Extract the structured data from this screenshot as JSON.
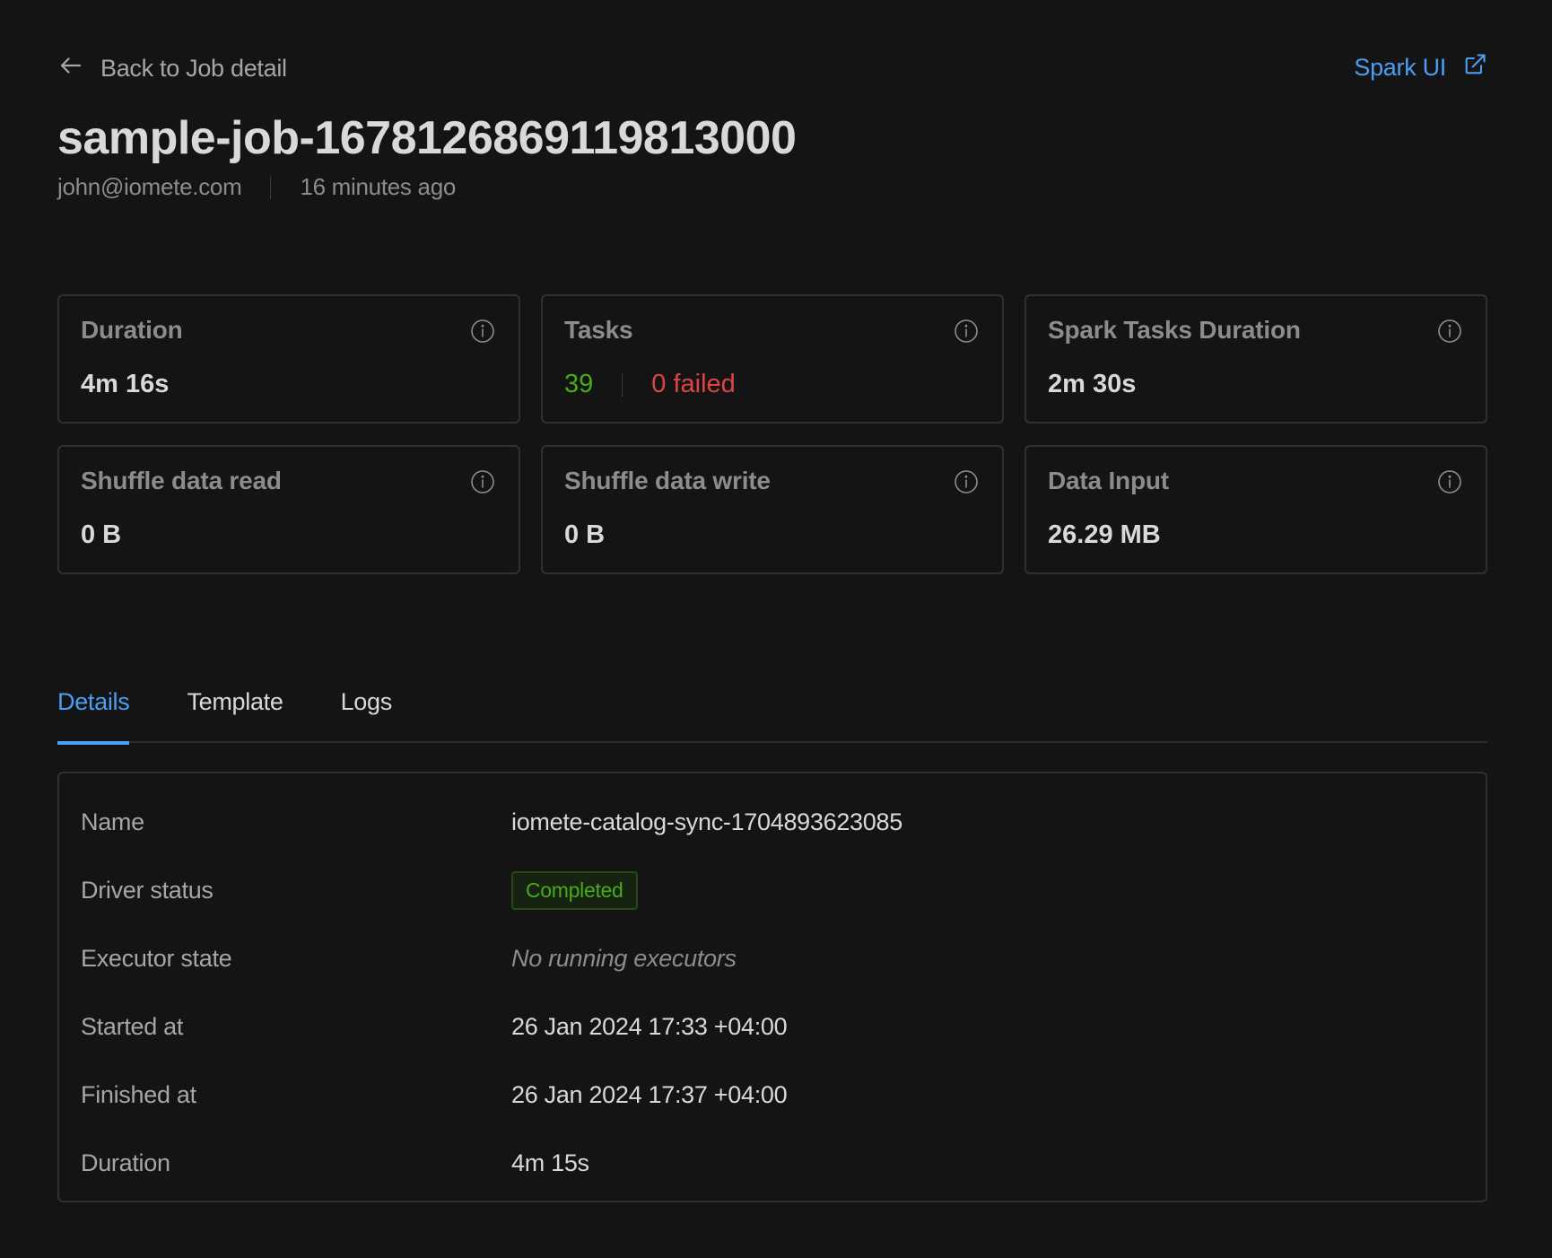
{
  "header": {
    "back_label": "Back to Job detail",
    "spark_ui_label": "Spark UI",
    "job_title": "sample-job-1678126869119813000",
    "user": "john@iomete.com",
    "time_ago": "16 minutes ago"
  },
  "cards": {
    "duration": {
      "label": "Duration",
      "value": "4m 16s"
    },
    "tasks": {
      "label": "Tasks",
      "success_count": "39",
      "failed_text": "0 failed"
    },
    "spark_tasks_duration": {
      "label": "Spark Tasks Duration",
      "value": "2m 30s"
    },
    "shuffle_read": {
      "label": "Shuffle data read",
      "value": "0 B"
    },
    "shuffle_write": {
      "label": "Shuffle data write",
      "value": "0 B"
    },
    "data_input": {
      "label": "Data Input",
      "value": "26.29 MB"
    }
  },
  "tabs": [
    {
      "label": "Details",
      "active": true
    },
    {
      "label": "Template",
      "active": false
    },
    {
      "label": "Logs",
      "active": false
    }
  ],
  "details": {
    "name": {
      "label": "Name",
      "value": "iomete-catalog-sync-1704893623085"
    },
    "driver_status": {
      "label": "Driver status",
      "value": "Completed"
    },
    "executor_state": {
      "label": "Executor state",
      "value": "No running executors"
    },
    "started_at": {
      "label": "Started at",
      "value": "26 Jan 2024 17:33 +04:00"
    },
    "finished_at": {
      "label": "Finished at",
      "value": "26 Jan 2024 17:37 +04:00"
    },
    "duration": {
      "label": "Duration",
      "value": "4m 15s"
    }
  },
  "icons": {
    "back": "arrow-left-icon",
    "external": "external-link-icon",
    "info": "info-circle-icon"
  },
  "colors": {
    "background": "#141414",
    "accent": "#4a9ff5",
    "success": "#49aa19",
    "error": "#dc4446"
  }
}
